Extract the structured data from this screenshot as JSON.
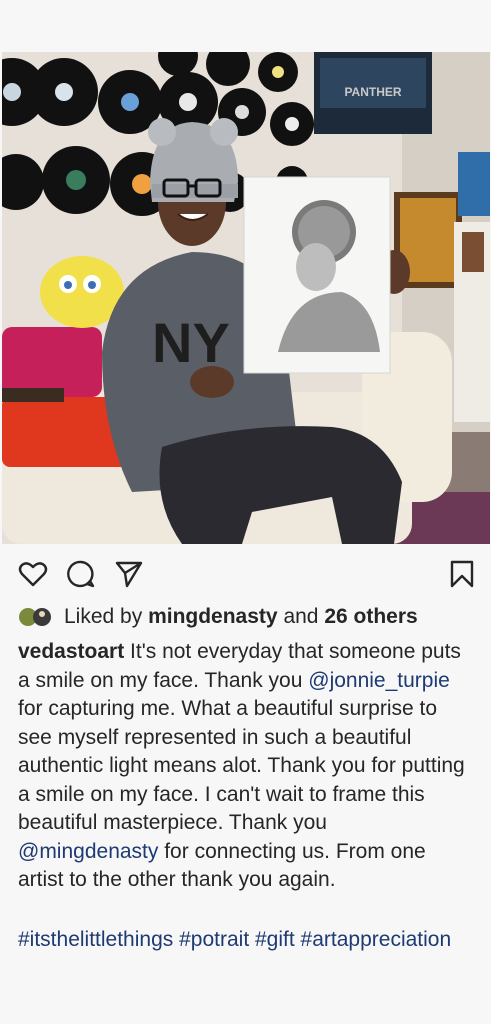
{
  "post": {
    "image_alt": "Person in a knitted hat and glasses holding up a pencil portrait drawing, vinyl records on the wall behind",
    "poster_title": "PANTHER"
  },
  "actions": {
    "like_icon": "heart-icon",
    "comment_icon": "comment-icon",
    "share_icon": "paper-plane-icon",
    "save_icon": "bookmark-icon"
  },
  "likes": {
    "prefix": "Liked by",
    "user": "mingdenasty",
    "joiner": "and",
    "others": "26 others"
  },
  "caption": {
    "username": "vedastoart",
    "text_1": " It's  not everyday that someone puts a smile on  my face. Thank you ",
    "mention_1": "@jonnie_turpie",
    "text_2": "  for capturing me. What a beautiful  surprise to see myself represented in such a  beautiful  authentic light means alot. Thank you for putting a smile on my face. I can't wait to frame this beautiful masterpiece. Thank you ",
    "mention_2": "@mingdenasty",
    "text_3": "  for connecting us. From one artist to the other  thank you again."
  },
  "hashtags": [
    "#itsthelittlethings",
    "#potrait",
    "#gift",
    "#artappreciation"
  ]
}
